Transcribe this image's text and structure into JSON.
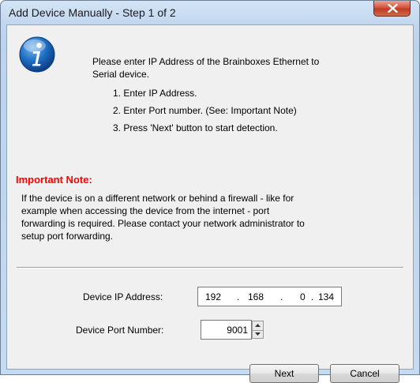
{
  "window": {
    "title": "Add Device Manually - Step 1 of 2"
  },
  "intro": {
    "line1": "Please enter IP Address of the Brainboxes Ethernet to",
    "line2": "Serial device.",
    "steps": [
      "1. Enter IP Address.",
      "2. Enter Port number. (See: Important Note)",
      "3. Press 'Next' button to start detection."
    ]
  },
  "note": {
    "heading": "Important Note:",
    "lines": [
      "If the device is on a different network or behind a firewall - like for",
      "example when accessing the device from the internet - port",
      "forwarding is required. Please contact your network administrator to",
      "setup port forwarding."
    ]
  },
  "form": {
    "ip_label": "Device IP Address:",
    "ip_octets": [
      "192",
      "168",
      "0",
      "134"
    ],
    "ip_separator": ".",
    "port_label": "Device Port Number:",
    "port_value": "9001"
  },
  "buttons": {
    "next": "Next",
    "cancel": "Cancel"
  },
  "icons": {
    "info": "information-icon",
    "close": "close-icon",
    "spin_up": "spin-up-arrow-icon",
    "spin_down": "spin-down-arrow-icon"
  },
  "colors": {
    "note_heading": "#ff0000",
    "close_button": "#c13a24"
  }
}
